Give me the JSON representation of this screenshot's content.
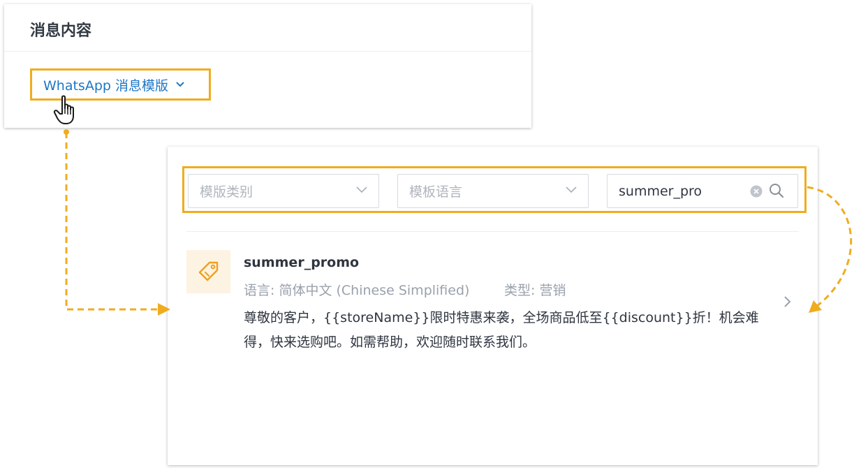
{
  "message_panel": {
    "title": "消息内容",
    "template_dropdown_label": "WhatsApp 消息模版"
  },
  "filters": {
    "category_placeholder": "模版类别",
    "language_placeholder": "模板语言",
    "search_value": "summer_pro"
  },
  "template": {
    "name": "summer_promo",
    "language": "语言: 简体中文 (Chinese Simplified)",
    "type": "类型: 营销",
    "body": "尊敬的客户，{{storeName}}限时特惠来袭，全场商品低至{{discount}}折！机会难得，快来选购吧。如需帮助，欢迎随时联系我们。"
  },
  "icons": {
    "dropdown": "chevron-down-icon",
    "cursor": "hand-pointer-icon",
    "clear": "clear-circle-icon",
    "search": "search-icon",
    "tag": "tag-icon",
    "open": "chevron-right-icon"
  },
  "colors": {
    "highlight": "#f0ac1f",
    "link": "#1e76c6",
    "tag_bg": "#fdf3e2"
  }
}
